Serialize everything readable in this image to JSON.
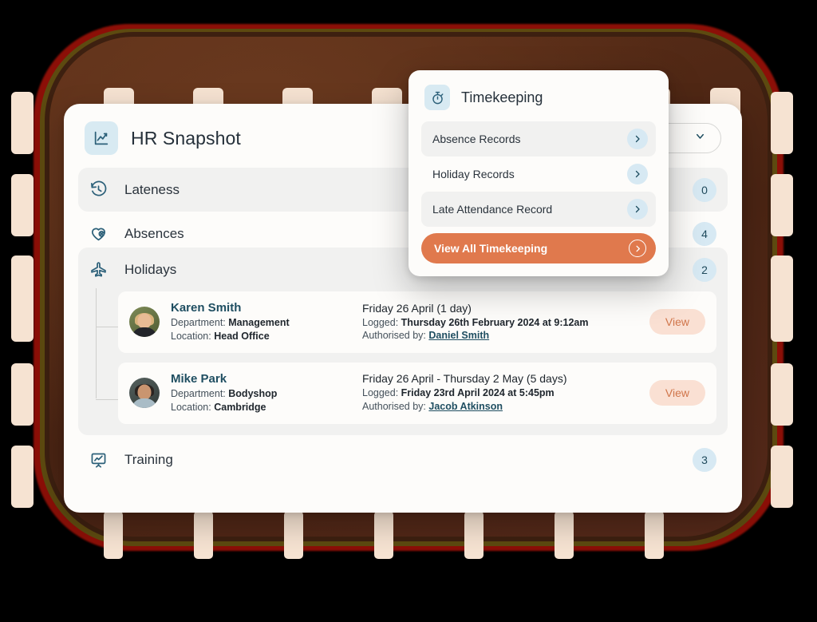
{
  "card": {
    "title": "HR Snapshot",
    "header_icon": "line-chart-icon",
    "select_icon": "chevron-down-icon",
    "rows": [
      {
        "label": "Lateness",
        "badge": "0",
        "icon": "clock-rewind-icon"
      },
      {
        "label": "Absences",
        "badge": "4",
        "icon": "heart-cross-icon"
      },
      {
        "label": "Holidays",
        "badge": "2",
        "icon": "airplane-icon"
      },
      {
        "label": "Training",
        "badge": "3",
        "icon": "presentation-chart-icon"
      }
    ]
  },
  "holidays": {
    "entries": [
      {
        "name": "Karen Smith",
        "department_label": "Department:",
        "department": "Management",
        "location_label": "Location:",
        "location": "Head Office",
        "range": "Friday 26 April (1 day)",
        "logged_label": "Logged:",
        "logged": "Thursday 26th February 2024 at 9:12am",
        "authorised_label": "Authorised by:",
        "authorised": "Daniel Smith",
        "action": "View"
      },
      {
        "name": "Mike Park",
        "department_label": "Department:",
        "department": "Bodyshop",
        "location_label": "Location:",
        "location": "Cambridge",
        "range": "Friday 26 April -  Thursday 2 May (5 days)",
        "logged_label": "Logged:",
        "logged": "Friday 23rd April 2024 at 5:45pm",
        "authorised_label": "Authorised by:",
        "authorised": "Jacob Atkinson",
        "action": "View"
      }
    ]
  },
  "popup": {
    "title": "Timekeeping",
    "icon": "stopwatch-icon",
    "items": [
      {
        "label": "Absence Records",
        "icon": "chevron-right-icon"
      },
      {
        "label": "Holiday Records",
        "icon": "chevron-right-icon"
      },
      {
        "label": "Late Attendance Record",
        "icon": "chevron-right-icon"
      }
    ],
    "cta_label": "View All Timekeeping",
    "cta_icon": "chevron-right-circle-icon"
  },
  "colors": {
    "accent_orange": "#e0794d",
    "accent_teal": "#1f4e61",
    "badge_blue": "#d7e9f3",
    "frame_brown": "#5a2d18",
    "frame_tab_cream": "#f6e3d2"
  }
}
